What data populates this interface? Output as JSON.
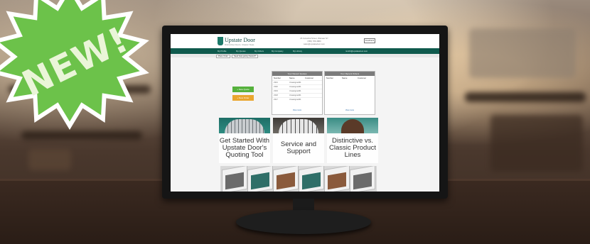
{
  "badge": {
    "text": "NEW!",
    "color": "#6cc24a"
  },
  "site": {
    "logo": "Upstate Door",
    "logo_sub": "Distinctive Doors. Classic Style.",
    "contact_lines": [
      "26 Industrial Street, Warsaw NY",
      "(585) 786-3880",
      "sales@upstatedoor.com"
    ],
    "feedback_label": "Feedback",
    "brand_color": "#0f5a4d"
  },
  "nav": {
    "items": [
      "My Profile",
      "My Quotes",
      "My Orders",
      "My Company",
      "My Library"
    ],
    "user": "rsmith@upstatedoor.com"
  },
  "subbar": {
    "crumbs": [
      "Place Order",
      "Need help getting Started?"
    ]
  },
  "actions": {
    "new_quote": "+ New Quote",
    "new_order": "+ New Order"
  },
  "recent_quotes": {
    "title": "Your Recent Quotes",
    "columns": [
      "Number",
      "Name",
      "Customer"
    ],
    "rows": [
      [
        "2321",
        "Unassigned01",
        ""
      ],
      [
        "2320",
        "Unassigned01",
        ""
      ],
      [
        "2319",
        "Unassigned01",
        ""
      ],
      [
        "2318",
        "Unassigned01",
        ""
      ],
      [
        "2317",
        "Unassigned01",
        ""
      ]
    ],
    "footer": "View more"
  },
  "recent_orders": {
    "title": "Your Recent Orders",
    "columns": [
      "Number",
      "Name",
      "Customer"
    ],
    "footer": "View more"
  },
  "tiles": [
    {
      "label": "Get Started With Upstate Door's Quoting Tool"
    },
    {
      "label": "Service and Support"
    },
    {
      "label": "Distinctive vs. Classic Product Lines"
    }
  ]
}
